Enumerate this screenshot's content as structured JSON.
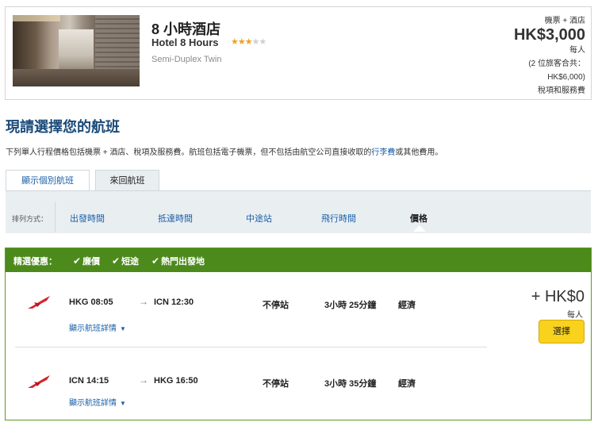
{
  "hotel": {
    "name_cn": "8 小時酒店",
    "name_en": "Hotel 8 Hours",
    "star_rating": 3,
    "max_stars": 5,
    "room_type": "Semi-Duplex Twin",
    "price_label": "機票 + 酒店",
    "price": "HK$3,000",
    "per_person": "每人",
    "travellers_note": "(2 位旅客合共：",
    "total": "HK$6,000)",
    "taxes_note": "稅項和服務費"
  },
  "page": {
    "title": "現請選擇您的航班",
    "notice_prefix": "下列單人行程價格包括機票 + 酒店、稅項及服務費。航班包括電子機票，但不包括由航空公司直接收取的",
    "notice_link": "行李費",
    "notice_suffix": "或其他費用。"
  },
  "tabs": [
    {
      "label": "顯示個別航班",
      "active": false
    },
    {
      "label": "來回航班",
      "active": true
    }
  ],
  "sort": {
    "label": "排列方式：",
    "options": [
      {
        "label": "出發時間"
      },
      {
        "label": "抵達時間"
      },
      {
        "label": "中途站"
      },
      {
        "label": "飛行時間"
      },
      {
        "label": "價格",
        "active": true
      }
    ]
  },
  "promo": {
    "label": "精選優惠：",
    "items": [
      "廉價",
      "短途",
      "熱門出發地"
    ]
  },
  "fare": {
    "price": "+ HK$0",
    "per_person": "每人",
    "select_label": "選擇"
  },
  "flights": [
    {
      "depart": "HKG 08:05",
      "arrive": "ICN 12:30",
      "stops": "不停站",
      "duration": "3小時 25分鐘",
      "cabin": "經濟",
      "details_label": "顯示航班詳情"
    },
    {
      "depart": "ICN 14:15",
      "arrive": "HKG 16:50",
      "stops": "不停站",
      "duration": "3小時 35分鐘",
      "cabin": "經濟",
      "details_label": "顯示航班詳情"
    }
  ],
  "colors": {
    "brand_blue": "#1b4b7a",
    "link_blue": "#1a5fa8",
    "promo_green": "#4c8a1c",
    "select_yellow": "#f8d21c",
    "star_gold": "#f0a020",
    "airline_red": "#d6232a"
  },
  "icons": {
    "check": "check-icon",
    "arrow": "arrow-right-icon",
    "chevron": "chevron-down-icon",
    "airline": "airline-logo-icon"
  }
}
